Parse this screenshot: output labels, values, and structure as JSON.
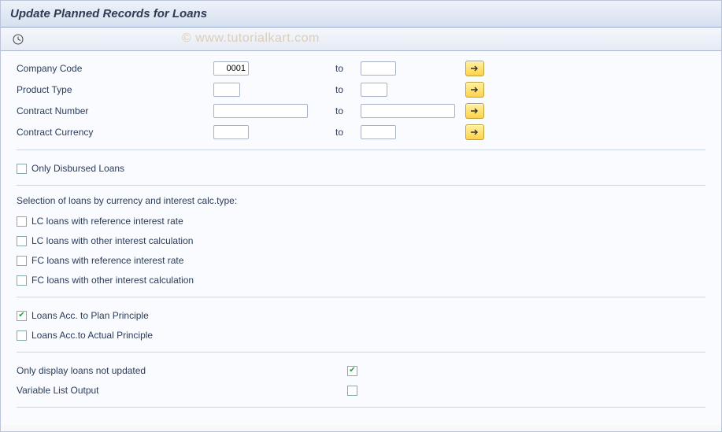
{
  "title": "Update Planned Records for Loans",
  "watermark": "© www.tutorialkart.com",
  "fields": {
    "company_code": {
      "label": "Company Code",
      "from": "0001",
      "to": "",
      "to_label": "to"
    },
    "product_type": {
      "label": "Product Type",
      "from": "",
      "to": "",
      "to_label": "to"
    },
    "contract_number": {
      "label": "Contract Number",
      "from": "",
      "to": "",
      "to_label": "to"
    },
    "contract_currency": {
      "label": "Contract Currency",
      "from": "",
      "to": "",
      "to_label": "to"
    }
  },
  "checkboxes": {
    "only_disbursed": {
      "label": "Only Disbursed Loans",
      "checked": false
    },
    "section_header": "Selection of loans by currency and interest calc.type:",
    "lc_ref": {
      "label": "LC loans with reference interest rate",
      "checked": false
    },
    "lc_other": {
      "label": "LC loans with other interest calculation",
      "checked": false
    },
    "fc_ref": {
      "label": "FC loans with reference interest rate",
      "checked": false
    },
    "fc_other": {
      "label": "FC loans with other interest calculation",
      "checked": false
    },
    "plan_principle": {
      "label": "Loans Acc. to Plan Principle",
      "checked": true
    },
    "actual_principle": {
      "label": "Loans Acc.to Actual Principle",
      "checked": false
    },
    "only_display": {
      "label": "Only display loans not updated",
      "checked": true
    },
    "variable_list": {
      "label": "Variable List Output",
      "checked": false
    }
  }
}
